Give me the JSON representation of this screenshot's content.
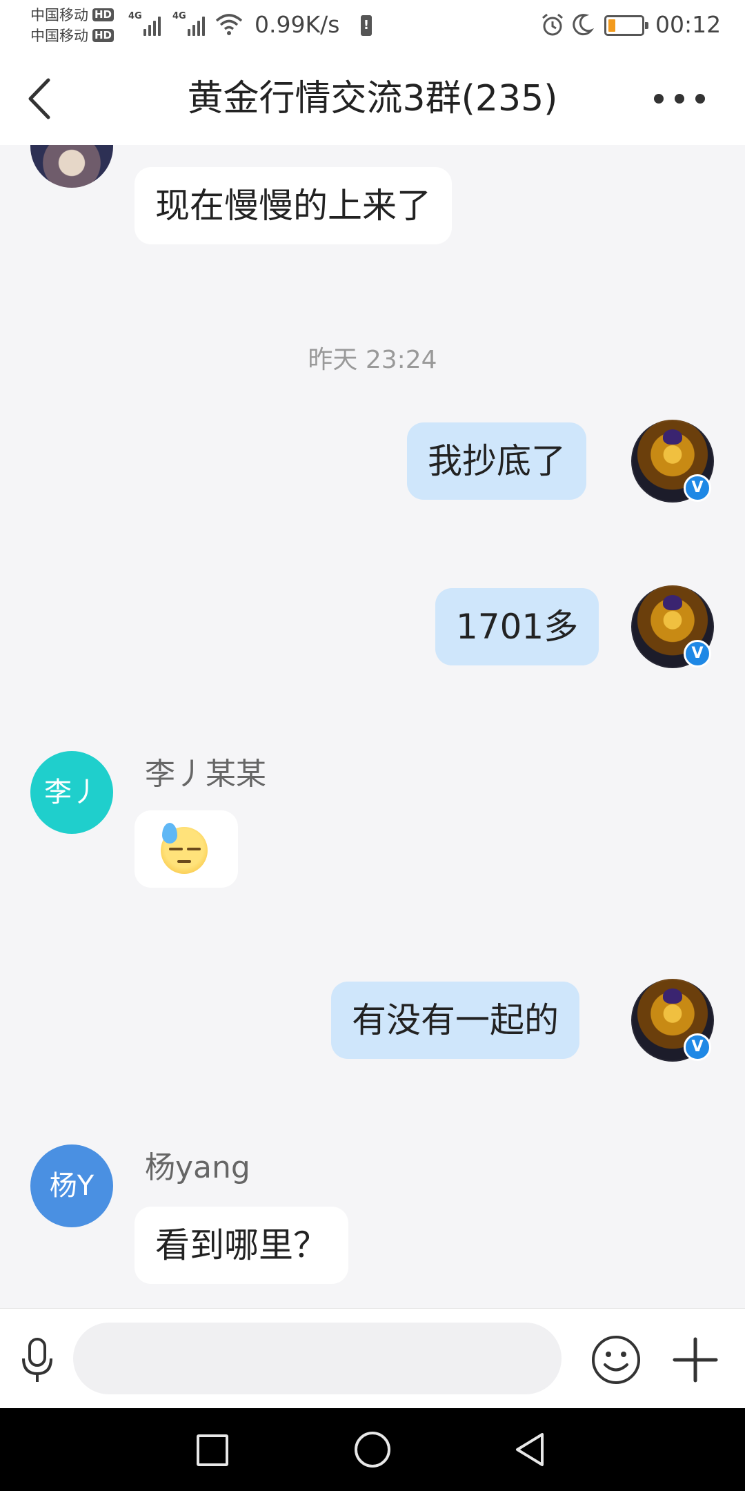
{
  "status_bar": {
    "carrier1": "中国移动",
    "carrier2": "中国移动",
    "hd_label": "HD",
    "net_tag": "4G",
    "net_speed": "0.99K/s",
    "battery_warning": "!",
    "time": "00:12",
    "battery_level": 0.2
  },
  "header": {
    "title": "黄金行情交流3群(235)"
  },
  "messages": [
    {
      "side": "in",
      "text": "现在慢慢的上来了"
    },
    {
      "type": "timestamp",
      "text": "昨天 23:24"
    },
    {
      "side": "out",
      "text": "我抄底了",
      "verified": "V"
    },
    {
      "side": "out",
      "text": "1701多",
      "verified": "V"
    },
    {
      "side": "in",
      "sender": "李丿某某",
      "avatar_text": "李丿",
      "emoji": "sweat-face"
    },
    {
      "side": "out",
      "text": "有没有一起的",
      "verified": "V"
    },
    {
      "side": "in",
      "sender": "杨yang",
      "avatar_text": "杨Y",
      "text": "看到哪里？"
    }
  ],
  "input_bar": {
    "placeholder": ""
  },
  "colors": {
    "outgoing_bubble": "#cfe6fb",
    "incoming_bubble": "#ffffff",
    "background": "#f5f5f7",
    "li_avatar": "#1fcfcc",
    "yang_avatar": "#4a90e2",
    "verified_badge": "#1f88e5"
  }
}
